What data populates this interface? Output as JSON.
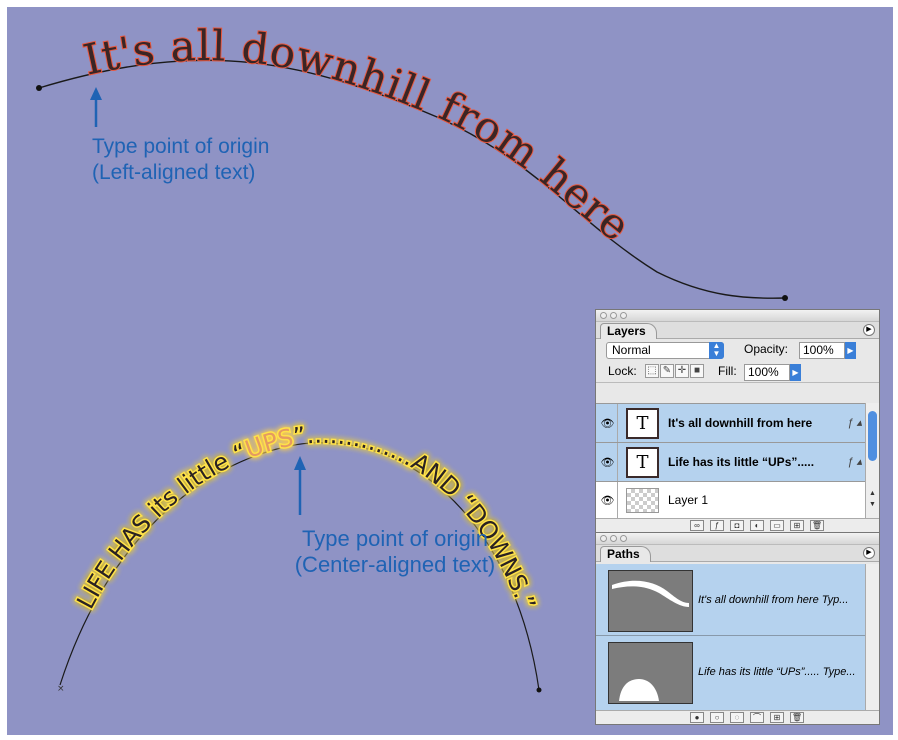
{
  "colors": {
    "canvas_background": "#8f93c5",
    "caption_text": "#1f63b4",
    "text_one_fill": "#3a2525",
    "text_one_outline": "#e8583f",
    "text_two_fill": "#2a2020",
    "text_two_glow": "#ffe24a",
    "highlight_word": "#e59b60",
    "selected_row": "#b5d2ee"
  },
  "artwork": {
    "text_on_path_one": "It's all downhill from here",
    "text_on_path_two_prefix": "LIFE HAS its little “",
    "text_on_path_two_highlight": "UPS",
    "text_on_path_two_suffix": "”..............AND “DOWNS.”"
  },
  "captions": {
    "left_line1": "Type point of origin",
    "left_line2": "(Left-aligned text)",
    "center_line1": "Type point of origin",
    "center_line2": "(Center-aligned text)"
  },
  "layers_palette": {
    "tab_label": "Layers",
    "blend_mode": "Normal",
    "opacity_label": "Opacity:",
    "opacity_value": "100%",
    "lock_label": "Lock:",
    "fill_label": "Fill:",
    "fill_value": "100%",
    "layers": [
      {
        "name": "It's all downhill from here",
        "type": "text-layer",
        "selected": true
      },
      {
        "name": "Life has its little “UPs”.....",
        "type": "text-layer",
        "selected": true
      },
      {
        "name": "Layer 1",
        "type": "image-layer",
        "selected": false
      }
    ]
  },
  "paths_palette": {
    "tab_label": "Paths",
    "paths": [
      {
        "name": "It's all downhill from here Typ..."
      },
      {
        "name": "Life has its little “UPs”..... Type..."
      }
    ]
  }
}
